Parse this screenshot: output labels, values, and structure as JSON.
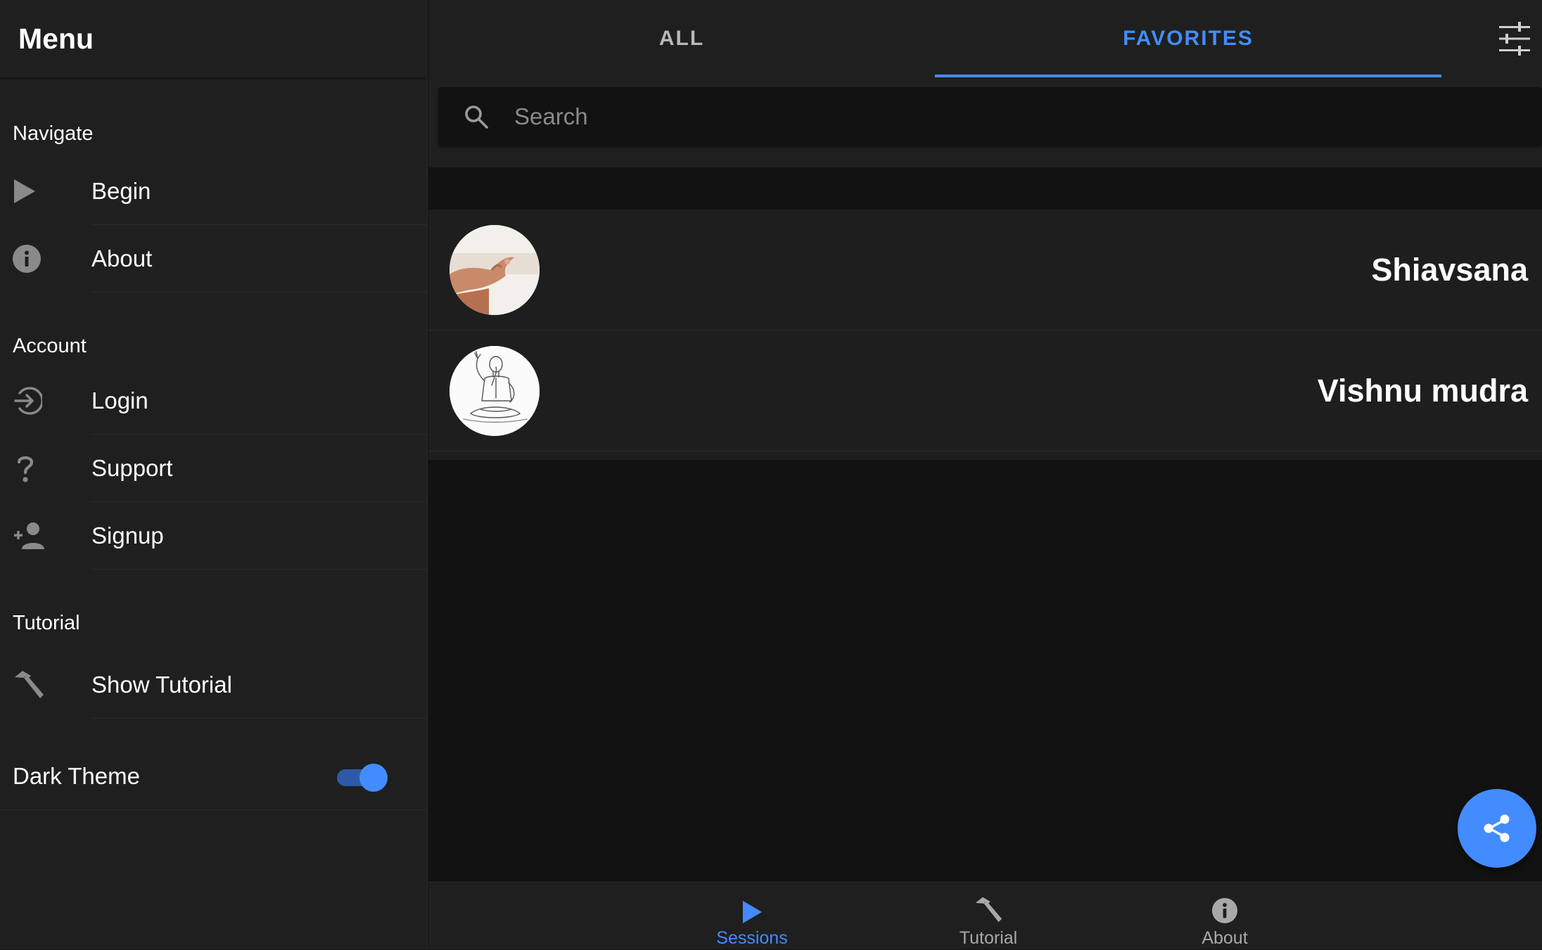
{
  "menu": {
    "title": "Menu",
    "sections": [
      {
        "title": "Navigate",
        "items": [
          {
            "label": "Begin",
            "icon": "play-icon"
          },
          {
            "label": "About",
            "icon": "info-icon"
          }
        ]
      },
      {
        "title": "Account",
        "items": [
          {
            "label": "Login",
            "icon": "login-icon"
          },
          {
            "label": "Support",
            "icon": "help-icon"
          },
          {
            "label": "Signup",
            "icon": "person-add-icon"
          }
        ]
      },
      {
        "title": "Tutorial",
        "items": [
          {
            "label": "Show Tutorial",
            "icon": "hammer-icon"
          }
        ]
      }
    ],
    "dark_theme": {
      "label": "Dark Theme",
      "enabled": true
    }
  },
  "tabs": [
    {
      "label": "ALL",
      "active": false
    },
    {
      "label": "FAVORITES",
      "active": true
    }
  ],
  "search": {
    "placeholder": "Search",
    "value": ""
  },
  "sessions": [
    {
      "name": "Shiavsana",
      "avatar": "meditation-hand-photo"
    },
    {
      "name": "Vishnu mudra",
      "avatar": "seated-yogi-sketch"
    }
  ],
  "tabbar": [
    {
      "label": "Sessions",
      "icon": "play-icon",
      "active": true
    },
    {
      "label": "Tutorial",
      "icon": "hammer-icon",
      "active": false
    },
    {
      "label": "About",
      "icon": "info-icon",
      "active": false
    }
  ],
  "colors": {
    "accent": "#428cff",
    "background": "#121212",
    "surface": "#1f1f1f",
    "text": "#ffffff",
    "muted": "#a8a8a8"
  }
}
